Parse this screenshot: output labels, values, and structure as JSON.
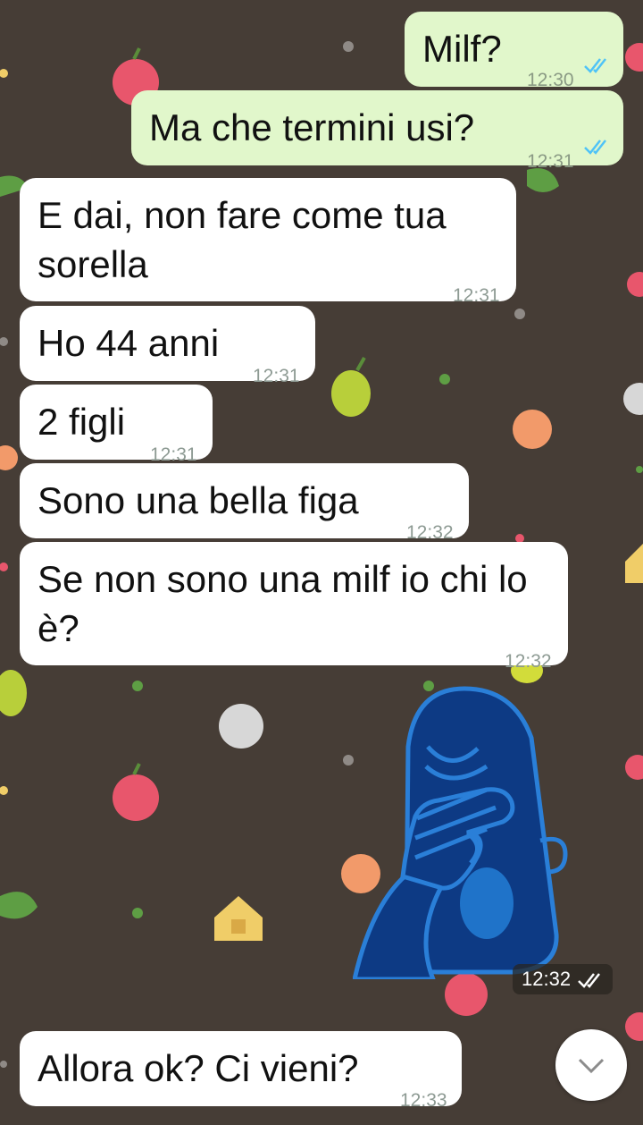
{
  "messages": [
    {
      "text": "Milf?",
      "time": "12:30"
    },
    {
      "text": "Ma che termini usi?",
      "time": "12:31"
    },
    {
      "text": "E dai, non fare come tua sorella",
      "time": "12:31"
    },
    {
      "text": "Ho 44 anni",
      "time": "12:31"
    },
    {
      "text": "2 figli",
      "time": "12:31"
    },
    {
      "text": "Sono una bella figa",
      "time": "12:32"
    },
    {
      "text": "Se non sono una milf io chi lo è?",
      "time": "12:32"
    },
    {
      "text": "Allora ok? Ci vieni?",
      "time": "12:33"
    }
  ],
  "sticker": {
    "time": "12:32"
  },
  "colors": {
    "wallpaper": "#463d36",
    "outgoing_bubble": "#e1f7cb",
    "incoming_bubble": "#ffffff",
    "read_ticks": "#4fc3f7",
    "sticker_body": "#0d3a84",
    "sticker_outline": "#2a7fd8"
  },
  "icons": [
    "double-check-icon",
    "chevron-down-icon",
    "facepalm-sticker"
  ]
}
